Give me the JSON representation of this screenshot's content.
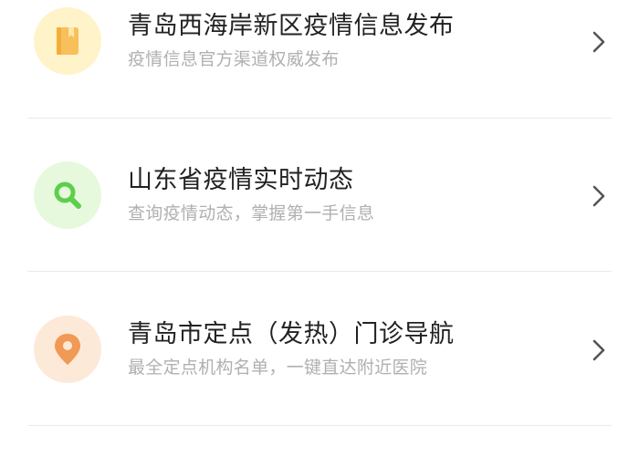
{
  "colors": {
    "book_bg": "#fff3c9",
    "book_fg": "#f7c05a",
    "search_bg": "#e6f9dc",
    "search_fg": "#5fce4c",
    "pin_bg": "#fde9d8",
    "pin_fg": "#f09a55",
    "title": "#222222",
    "subtitle": "#b0b0b0",
    "chevron": "#555555",
    "divider": "#ebebeb"
  },
  "items": [
    {
      "icon": "book-icon",
      "title": "青岛西海岸新区疫情信息发布",
      "subtitle": "疫情信息官方渠道权威发布"
    },
    {
      "icon": "search-icon",
      "title": "山东省疫情实时动态",
      "subtitle": "查询疫情动态，掌握第一手信息"
    },
    {
      "icon": "location-pin-icon",
      "title": "青岛市定点（发热）门诊导航",
      "subtitle": "最全定点机构名单，一键直达附近医院"
    }
  ]
}
